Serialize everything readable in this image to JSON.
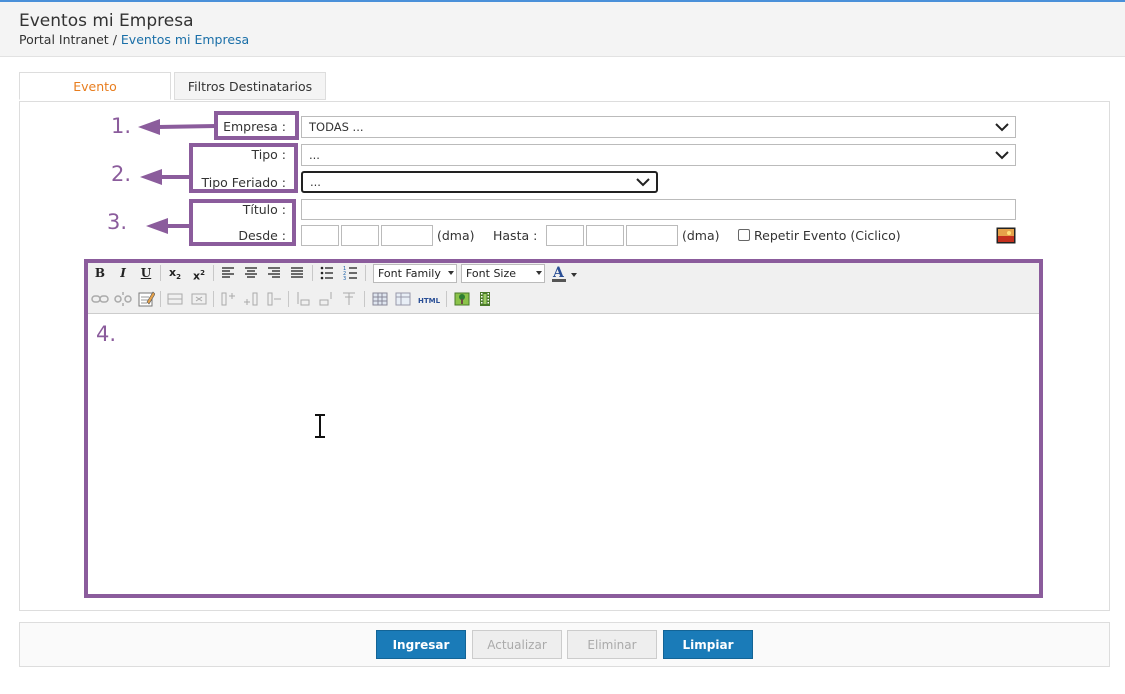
{
  "header": {
    "title": "Eventos mi Empresa",
    "breadcrumb_root": "Portal Intranet",
    "breadcrumb_sep": "/",
    "breadcrumb_current": "Eventos mi Empresa"
  },
  "tabs": [
    {
      "label": "Evento",
      "active": true
    },
    {
      "label": "Filtros Destinatarios",
      "active": false
    }
  ],
  "form": {
    "empresa_label": "Empresa :",
    "empresa_value": "TODAS ...",
    "tipo_label": "Tipo :",
    "tipo_value": "...",
    "tipo_feriado_label": "Tipo Feriado :",
    "tipo_feriado_value": "...",
    "titulo_label": "Título :",
    "titulo_value": "",
    "desde_label": "Desde :",
    "desde_format": "(dma)",
    "hasta_label": "Hasta :",
    "hasta_format": "(dma)",
    "repetir_label": "Repetir Evento (Ciclico)"
  },
  "editor": {
    "font_family_label": "Font Family",
    "font_size_label": "Font Size",
    "content": ""
  },
  "annotations": {
    "n1": "1.",
    "n2": "2.",
    "n3": "3.",
    "n4": "4.",
    "color": "#8b5c9c"
  },
  "buttons": {
    "ingresar": "Ingresar",
    "actualizar": "Actualizar",
    "eliminar": "Eliminar",
    "limpiar": "Limpiar"
  },
  "colors": {
    "accent": "#1a7bb8",
    "active_tab": "#e87d1e",
    "link": "#1a6fa8"
  }
}
